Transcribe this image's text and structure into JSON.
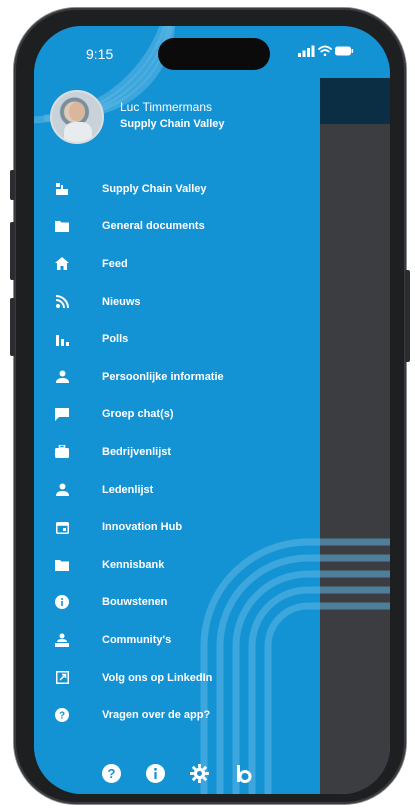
{
  "status_bar": {
    "time": "9:15",
    "icons": [
      "cellular-signal-icon",
      "wifi-icon",
      "battery-icon"
    ]
  },
  "profile": {
    "name": "Luc Timmermans",
    "organization": "Supply Chain Valley"
  },
  "menu": {
    "items": [
      {
        "label": "Supply Chain Valley",
        "icon": "organization-icon"
      },
      {
        "label": "General documents",
        "icon": "folder-icon"
      },
      {
        "label": "Feed",
        "icon": "home-icon"
      },
      {
        "label": "Nieuws",
        "icon": "rss-icon"
      },
      {
        "label": "Polls",
        "icon": "bar-chart-icon"
      },
      {
        "label": "Persoonlijke informatie",
        "icon": "person-icon"
      },
      {
        "label": "Groep chat(s)",
        "icon": "chat-icon"
      },
      {
        "label": "Bedrijvenlijst",
        "icon": "briefcase-icon"
      },
      {
        "label": "Ledenlijst",
        "icon": "person-icon"
      },
      {
        "label": "Innovation Hub",
        "icon": "calendar-icon"
      },
      {
        "label": "Kennisbank",
        "icon": "folder-icon"
      },
      {
        "label": "Bouwstenen",
        "icon": "info-circle-icon"
      },
      {
        "label": "Community's",
        "icon": "community-icon"
      },
      {
        "label": "Volg ons op LinkedIn",
        "icon": "external-link-icon"
      },
      {
        "label": "Vragen over de app?",
        "icon": "help-circle-icon"
      }
    ]
  },
  "bottom_bar": {
    "icons": [
      "help-icon",
      "info-icon",
      "settings-gear-icon",
      "brand-logo-icon"
    ]
  },
  "colors": {
    "drawer_background": "#1493d4",
    "overlay": "#3b3d40",
    "header_dark": "#0c2e44",
    "text": "#ffffff",
    "phone_frame": "#1e1f21"
  }
}
